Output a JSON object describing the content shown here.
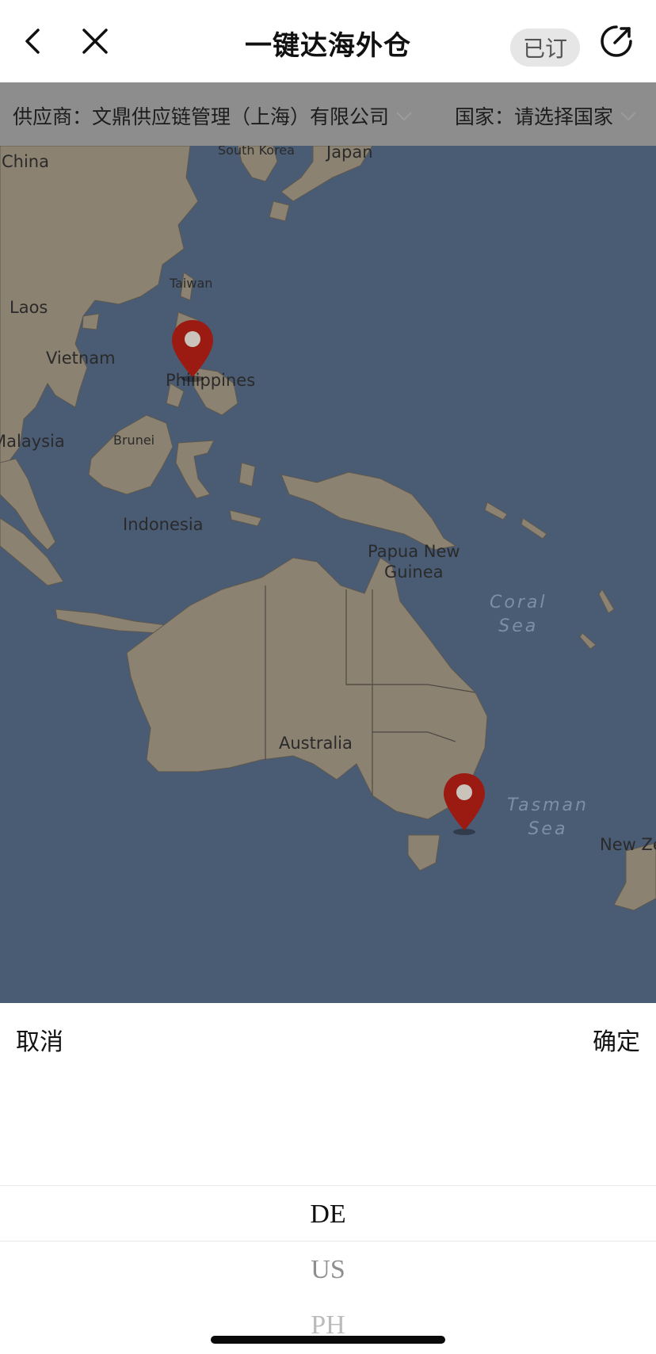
{
  "header": {
    "title": "一键达海外仓",
    "subscribed_label": "已订"
  },
  "filters": {
    "supplier_label": "供应商：文鼎供应链管理（上海）有限公司",
    "country_label": "国家：请选择国家"
  },
  "map": {
    "labels": {
      "china": "China",
      "south_korea": "South Korea",
      "japan": "Japan",
      "taiwan": "Taiwan",
      "laos": "Laos",
      "vietnam": "Vietnam",
      "philippines": "Philippines",
      "malaysia": "Malaysia",
      "brunei": "Brunei",
      "indonesia": "Indonesia",
      "papua_1": "Papua New",
      "papua_2": "Guinea",
      "coral_1": "Coral",
      "coral_2": "Sea",
      "australia": "Australia",
      "tasman_1": "Tasman",
      "tasman_2": "Sea",
      "new_zealand": "New Ze"
    },
    "colors": {
      "water": "#4a5b74",
      "land": "#8b8272",
      "pin": "#9b1b12"
    }
  },
  "picker": {
    "cancel_label": "取消",
    "confirm_label": "确定",
    "options": [
      "DE",
      "US",
      "PH"
    ],
    "selected": "DE"
  }
}
